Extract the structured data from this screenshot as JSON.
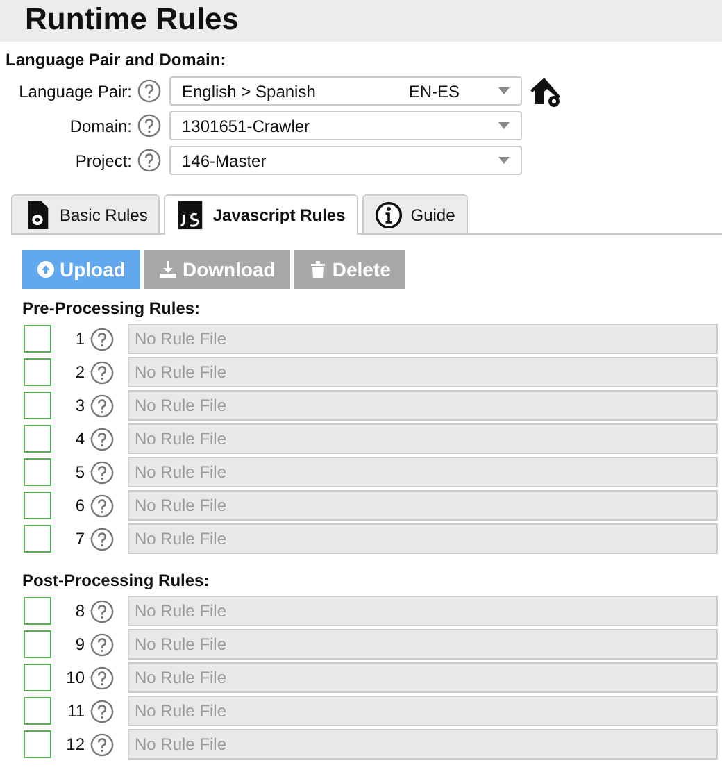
{
  "title": "Runtime Rules",
  "section": "Language Pair and Domain:",
  "selects": [
    {
      "label": "Language Pair:",
      "value": "English > Spanish",
      "code": "EN-ES"
    },
    {
      "label": "Domain:",
      "value": "1301651-Crawler"
    },
    {
      "label": "Project:",
      "value": "146-Master"
    }
  ],
  "tabs": [
    {
      "label": "Basic Rules",
      "kind": "file",
      "selected": false
    },
    {
      "label": "Javascript Rules",
      "kind": "js",
      "selected": true
    },
    {
      "label": "Guide",
      "kind": "info",
      "selected": false
    }
  ],
  "buttons": [
    {
      "label": "Upload",
      "kind": "upload",
      "disabled": false
    },
    {
      "label": "Download",
      "kind": "download",
      "disabled": true
    },
    {
      "label": "Delete",
      "kind": "delete",
      "disabled": true
    }
  ],
  "groups": [
    {
      "heading": "Pre-Processing Rules:",
      "rules": [
        {
          "number": "1",
          "checked": false,
          "placeholder": "No Rule File"
        },
        {
          "number": "2",
          "checked": false,
          "placeholder": "No Rule File"
        },
        {
          "number": "3",
          "checked": false,
          "placeholder": "No Rule File"
        },
        {
          "number": "4",
          "checked": false,
          "placeholder": "No Rule File"
        },
        {
          "number": "5",
          "checked": false,
          "placeholder": "No Rule File"
        },
        {
          "number": "6",
          "checked": false,
          "placeholder": "No Rule File"
        },
        {
          "number": "7",
          "checked": false,
          "placeholder": "No Rule File"
        }
      ]
    },
    {
      "heading": "Post-Processing Rules:",
      "rules": [
        {
          "number": "8",
          "checked": false,
          "placeholder": "No Rule File"
        },
        {
          "number": "9",
          "checked": false,
          "placeholder": "No Rule File"
        },
        {
          "number": "10",
          "checked": false,
          "placeholder": "No Rule File"
        },
        {
          "number": "11",
          "checked": false,
          "placeholder": "No Rule File"
        },
        {
          "number": "12",
          "checked": false,
          "placeholder": "No Rule File"
        }
      ]
    }
  ]
}
